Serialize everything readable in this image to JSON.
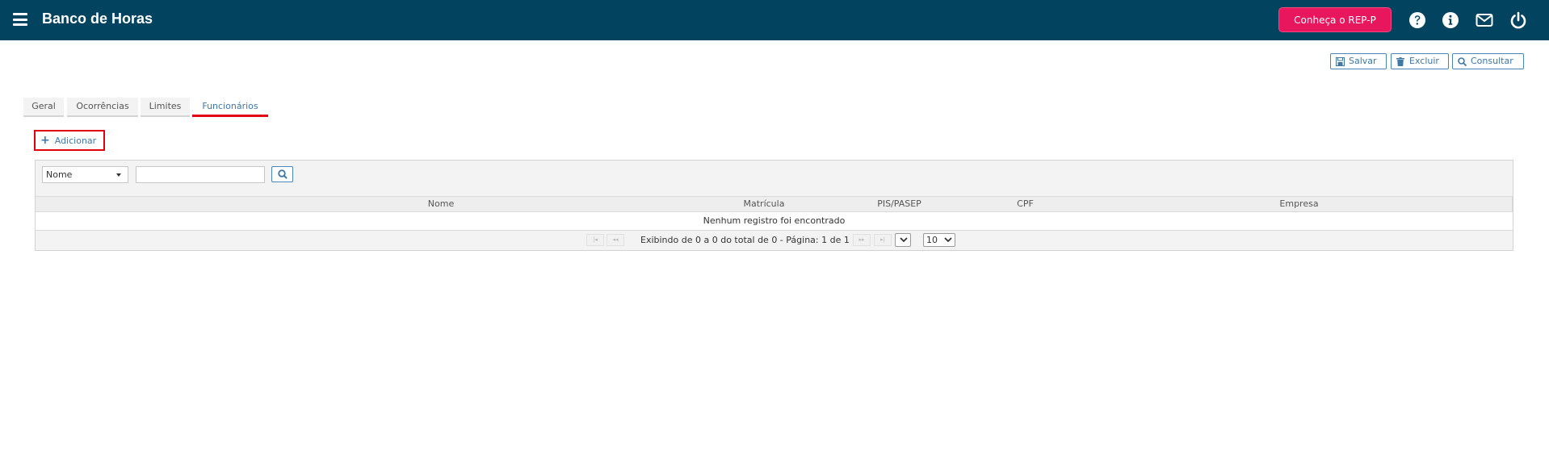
{
  "header": {
    "title": "Banco de Horas",
    "promo_button": "Conheça o REP-P",
    "icons": [
      "help-icon",
      "info-icon",
      "mail-icon",
      "power-icon"
    ],
    "bg_color": "#02435f",
    "promo_color": "#e8175d"
  },
  "toolbar": {
    "save_label": "Salvar",
    "delete_label": "Excluir",
    "query_label": "Consultar"
  },
  "tabs": [
    {
      "label": "Geral"
    },
    {
      "label": "Ocorrências"
    },
    {
      "label": "Limites"
    },
    {
      "label": "Funcionários",
      "active": true
    }
  ],
  "add_button": "Adicionar",
  "grid": {
    "filter_field": "Nome",
    "search_value": "",
    "columns": [
      "",
      "Nome",
      "Matrícula",
      "PIS/PASEP",
      "CPF",
      "Empresa"
    ],
    "empty_message": "Nenhum registro foi encontrado",
    "pager": {
      "status": "Exibindo de 0 a 0 do total de 0 - Página: 1 de 1",
      "page_size": "10"
    }
  }
}
